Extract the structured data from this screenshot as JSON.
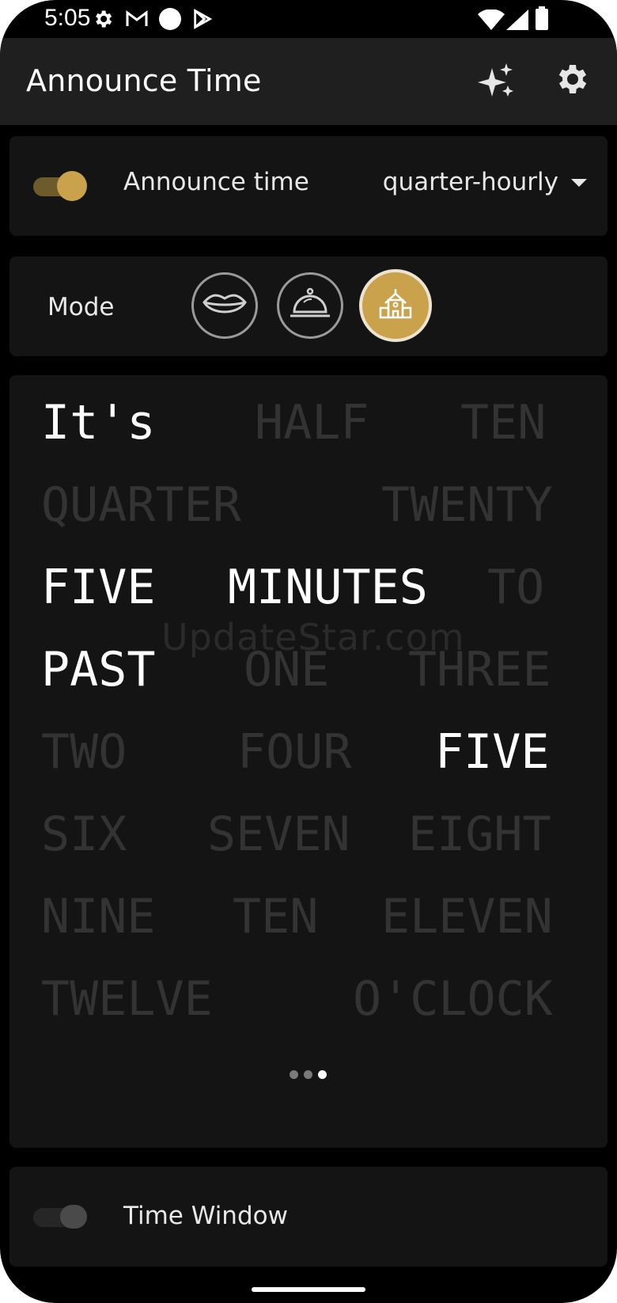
{
  "status_bar": {
    "time": "5:05",
    "icons": [
      "settings-icon",
      "gmail-icon",
      "circle-icon",
      "play-store-icon",
      "wifi-icon",
      "signal-icon",
      "battery-icon"
    ]
  },
  "app_bar": {
    "title": "Announce Time",
    "actions": [
      "sparkles-icon",
      "gear-icon"
    ]
  },
  "announce_card": {
    "toggle_on": true,
    "label": "Announce time",
    "interval": "quarter-hourly"
  },
  "mode_card": {
    "label": "Mode",
    "modes": [
      "lips-icon",
      "service-bell-icon",
      "schoolhouse-icon"
    ],
    "selected": "schoolhouse-icon"
  },
  "word_clock": {
    "words": [
      {
        "text": "It's",
        "lit": true
      },
      {
        "text": "HALF",
        "lit": false
      },
      {
        "text": "TEN",
        "lit": false
      },
      {
        "text": "QUARTER",
        "lit": false
      },
      {
        "text": "TWENTY",
        "lit": false
      },
      {
        "text": "FIVE",
        "lit": true
      },
      {
        "text": "MINUTES",
        "lit": true
      },
      {
        "text": "TO",
        "lit": false
      },
      {
        "text": "PAST",
        "lit": true
      },
      {
        "text": "ONE",
        "lit": false
      },
      {
        "text": "THREE",
        "lit": false
      },
      {
        "text": "TWO",
        "lit": false
      },
      {
        "text": "FOUR",
        "lit": false
      },
      {
        "text": "FIVE",
        "lit": true
      },
      {
        "text": "SIX",
        "lit": false
      },
      {
        "text": "SEVEN",
        "lit": false
      },
      {
        "text": "EIGHT",
        "lit": false
      },
      {
        "text": "NINE",
        "lit": false
      },
      {
        "text": "TEN",
        "lit": false
      },
      {
        "text": "ELEVEN",
        "lit": false
      },
      {
        "text": "TWELVE",
        "lit": false
      },
      {
        "text": "O'CLOCK",
        "lit": false
      }
    ],
    "watermark": "UpdateStar.com",
    "page_count": 3,
    "current_page": 3
  },
  "time_window_card": {
    "toggle_on": false,
    "label": "Time Window"
  },
  "colors": {
    "accent": "#c9a24b",
    "background": "#000000",
    "card": "#141414",
    "app_bar": "#1f1f1f",
    "word_lit": "#ffffff",
    "word_dim": "#333333"
  }
}
